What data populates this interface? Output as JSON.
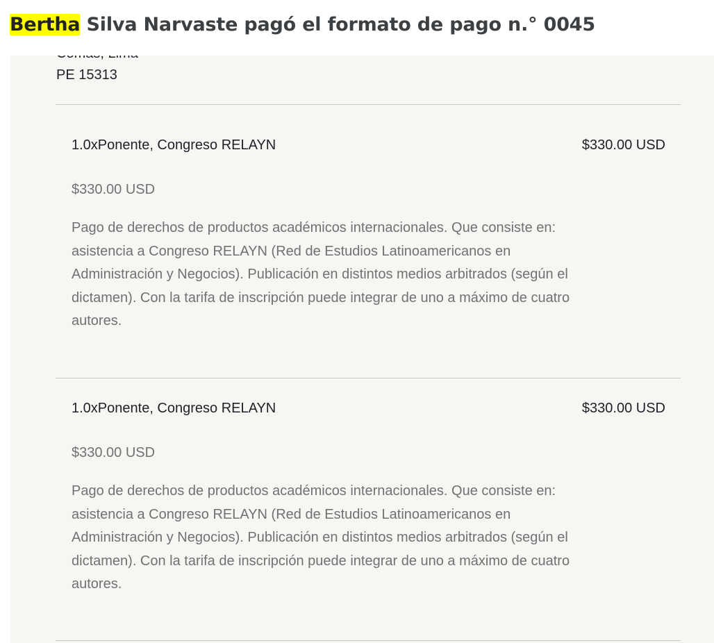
{
  "email": {
    "subject_highlight": "Bertha",
    "subject_rest": " Silva Narvaste pagó el formato de pago n.° 0045"
  },
  "address": {
    "city": "Comas, Lima",
    "postal": "PE 15313"
  },
  "items": [
    {
      "name": "1.0xPonente, Congreso RELAYN",
      "total": "$330.00 USD",
      "unit_price": "$330.00 USD",
      "description": "Pago de derechos de productos académicos internacionales. Que consiste en: asistencia a Congreso RELAYN (Red de Estudios Latinoamericanos en Administración y Negocios). Publicación en distintos medios arbitrados (según el dictamen). Con la tarifa de inscripción puede integrar de uno a máximo de cuatro autores."
    },
    {
      "name": "1.0xPonente, Congreso RELAYN",
      "total": "$330.00 USD",
      "unit_price": "$330.00 USD",
      "description": "Pago de derechos de productos académicos internacionales. Que consiste en: asistencia a Congreso RELAYN (Red de Estudios Latinoamericanos en Administración y Negocios). Publicación en distintos medios arbitrados (según el dictamen). Con la tarifa de inscripción puede integrar de uno a máximo de cuatro autores."
    }
  ],
  "colors": {
    "highlight": "#ffff00",
    "panel_background": "#f7f6f3",
    "primary_text": "#1e2127",
    "secondary_text": "#6f7173"
  }
}
